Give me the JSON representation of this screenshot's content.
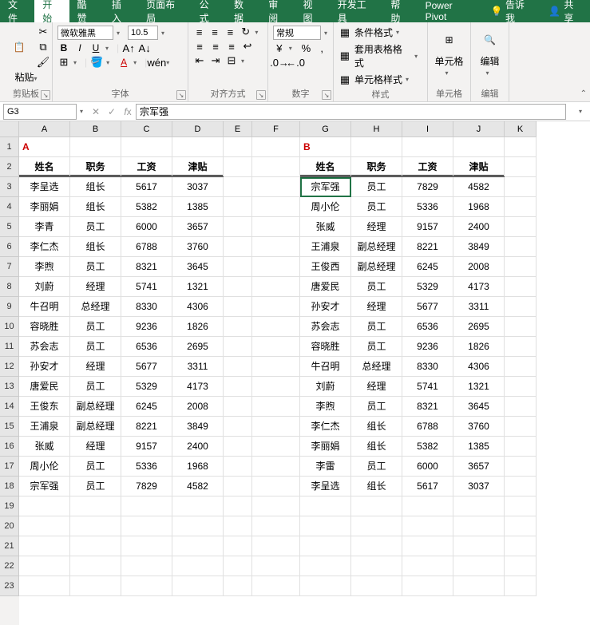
{
  "tabs": {
    "file": "文件",
    "home": "开始",
    "cool": "酷赞",
    "insert": "插入",
    "layout": "页面布局",
    "formulas": "公式",
    "data": "数据",
    "review": "审阅",
    "view": "视图",
    "dev": "开发工具",
    "help": "帮助",
    "powerpivot": "Power Pivot",
    "tellme": "告诉我",
    "share": "共享"
  },
  "ribbon": {
    "clipboard": {
      "label": "剪贴板",
      "paste": "粘贴"
    },
    "font": {
      "label": "字体",
      "name": "微软雅黑",
      "size": "10.5"
    },
    "align": {
      "label": "对齐方式"
    },
    "number": {
      "label": "数字",
      "format": "常规"
    },
    "styles": {
      "label": "样式",
      "cond": "条件格式",
      "table": "套用表格格式",
      "cell": "单元格样式"
    },
    "cells": {
      "label": "单元格"
    },
    "editing": {
      "label": "编辑"
    }
  },
  "namebox": "G3",
  "formula": "宗军强",
  "columns": [
    "A",
    "B",
    "C",
    "D",
    "E",
    "F",
    "G",
    "H",
    "I",
    "J",
    "K"
  ],
  "colwidths": [
    "wA",
    "wB",
    "wC",
    "wD",
    "wE",
    "wF",
    "wG",
    "wH",
    "wI",
    "wJ",
    "wK"
  ],
  "markerA": "A",
  "markerB": "B",
  "headers": [
    "姓名",
    "职务",
    "工资",
    "津贴"
  ],
  "tableA": [
    [
      "李呈选",
      "组长",
      "5617",
      "3037"
    ],
    [
      "李丽娟",
      "组长",
      "5382",
      "1385"
    ],
    [
      "李青",
      "员工",
      "6000",
      "3657"
    ],
    [
      "李仁杰",
      "组长",
      "6788",
      "3760"
    ],
    [
      "李煦",
      "员工",
      "8321",
      "3645"
    ],
    [
      "刘蔚",
      "经理",
      "5741",
      "1321"
    ],
    [
      "牛召明",
      "总经理",
      "8330",
      "4306"
    ],
    [
      "容晓胜",
      "员工",
      "9236",
      "1826"
    ],
    [
      "苏会志",
      "员工",
      "6536",
      "2695"
    ],
    [
      "孙安才",
      "经理",
      "5677",
      "3311"
    ],
    [
      "唐爱民",
      "员工",
      "5329",
      "4173"
    ],
    [
      "王俊东",
      "副总经理",
      "6245",
      "2008"
    ],
    [
      "王浦泉",
      "副总经理",
      "8221",
      "3849"
    ],
    [
      "张威",
      "经理",
      "9157",
      "2400"
    ],
    [
      "周小伦",
      "员工",
      "5336",
      "1968"
    ],
    [
      "宗军强",
      "员工",
      "7829",
      "4582"
    ]
  ],
  "tableB": [
    [
      "宗军强",
      "员工",
      "7829",
      "4582"
    ],
    [
      "周小伦",
      "员工",
      "5336",
      "1968"
    ],
    [
      "张威",
      "经理",
      "9157",
      "2400"
    ],
    [
      "王浦泉",
      "副总经理",
      "8221",
      "3849"
    ],
    [
      "王俊西",
      "副总经理",
      "6245",
      "2008"
    ],
    [
      "唐爱民",
      "员工",
      "5329",
      "4173"
    ],
    [
      "孙安才",
      "经理",
      "5677",
      "3311"
    ],
    [
      "苏会志",
      "员工",
      "6536",
      "2695"
    ],
    [
      "容晓胜",
      "员工",
      "9236",
      "1826"
    ],
    [
      "牛召明",
      "总经理",
      "8330",
      "4306"
    ],
    [
      "刘蔚",
      "经理",
      "5741",
      "1321"
    ],
    [
      "李煦",
      "员工",
      "8321",
      "3645"
    ],
    [
      "李仁杰",
      "组长",
      "6788",
      "3760"
    ],
    [
      "李丽娟",
      "组长",
      "5382",
      "1385"
    ],
    [
      "李雷",
      "员工",
      "6000",
      "3657"
    ],
    [
      "李呈选",
      "组长",
      "5617",
      "3037"
    ]
  ],
  "activeCell": {
    "row": 3,
    "col": "G"
  }
}
